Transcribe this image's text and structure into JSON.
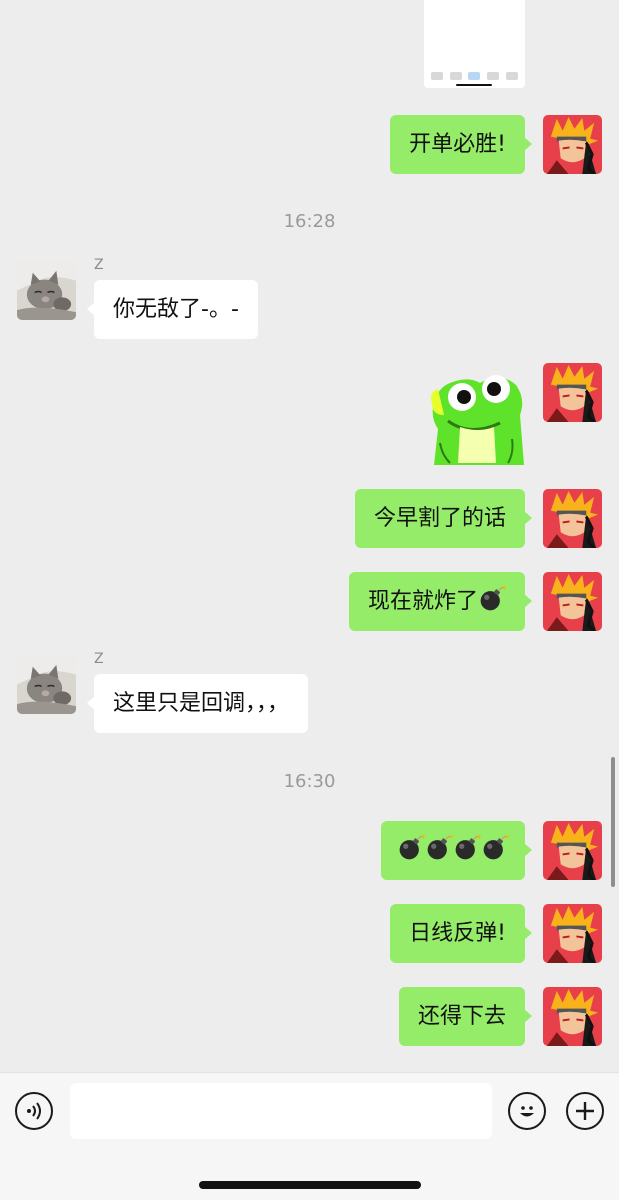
{
  "chat": {
    "timestamps": [
      "16:28",
      "16:30"
    ],
    "other_user_name": "Z",
    "messages": {
      "m1": "开单必胜!",
      "m2": "你无敌了-。-",
      "m3": "今早割了的话",
      "m4": "现在就炸了",
      "m5": "这里只是回调，，，",
      "m7": "日线反弹!",
      "m8": "还得下去"
    },
    "bomb_emoji": "💣",
    "bomb_count_m6": 4
  },
  "icons": {
    "voice": "voice-input-icon",
    "emoji": "emoji-icon",
    "plus": "more-plus-icon",
    "bomb": "bomb-icon"
  },
  "colors": {
    "mine_bubble": "#95ec69",
    "theirs_bubble": "#ffffff",
    "background": "#ededed"
  },
  "input": {
    "value": ""
  }
}
